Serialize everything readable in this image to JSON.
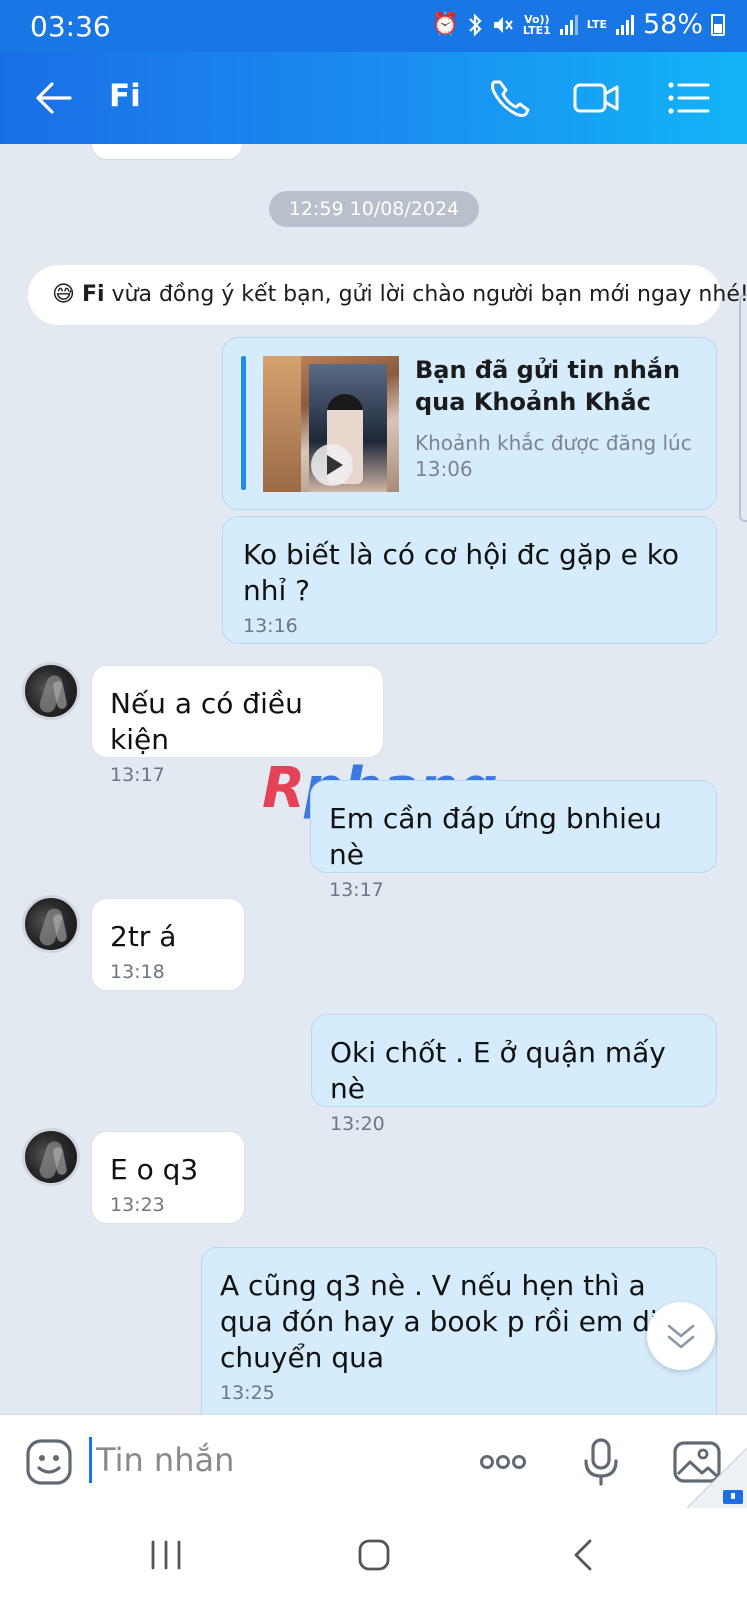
{
  "status_bar": {
    "time": "03:36",
    "network": "LTE",
    "volte": "Vo)) LTE1",
    "battery": "58%"
  },
  "header": {
    "contact_name": "Fi"
  },
  "chat": {
    "date_separator": "12:59 10/08/2024",
    "system_message": {
      "emoji": "😅",
      "name": "Fi",
      "text": "vừa đồng ý kết bạn, gửi lời chào người bạn mới ngay nhé!"
    },
    "moment_card": {
      "title": "Bạn đã gửi tin nhắn qua Khoảnh Khắc",
      "subtitle": "Khoảnh khắc được đăng lúc 13:06"
    },
    "messages": [
      {
        "direction": "out",
        "text": "Ko biết là có cơ hội đc gặp e ko nhỉ ?",
        "time": "13:16"
      },
      {
        "direction": "in",
        "text": "Nếu a có điều kiện",
        "time": "13:17"
      },
      {
        "direction": "out",
        "text": "Em cần đáp ứng bnhieu nè",
        "time": "13:17"
      },
      {
        "direction": "in",
        "text": "2tr á",
        "time": "13:18"
      },
      {
        "direction": "out",
        "text": "Oki chốt . E ở quận mấy nè",
        "time": "13:20"
      },
      {
        "direction": "in",
        "text": "E o q3",
        "time": "13:23"
      },
      {
        "direction": "out",
        "text": "A cũng q3 nè . V nếu hẹn thì a qua đón hay a book p rồi em di chuyển qua",
        "time": "13:25"
      }
    ]
  },
  "watermark": {
    "first": "R",
    "rest": "phang"
  },
  "input": {
    "placeholder": "Tin nhắn"
  },
  "colors": {
    "header_start": "#1a6fe6",
    "header_end": "#12b4f7",
    "outgoing_bubble": "#d5ecfd",
    "incoming_bubble": "#ffffff",
    "chat_background": "#e2e9f1"
  }
}
